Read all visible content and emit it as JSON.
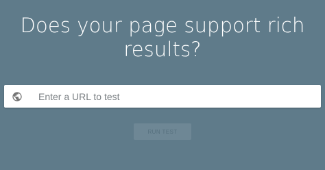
{
  "headline": {
    "line1": "Does your page support rich",
    "line2": "results?"
  },
  "url_field": {
    "value": "",
    "placeholder": "Enter a URL to test",
    "icon": "globe-icon"
  },
  "run_button": {
    "label": "RUN TEST",
    "disabled": true
  },
  "colors": {
    "background": "#5f7b8a",
    "headline_text": "#ffffff",
    "input_background": "#ffffff",
    "button_background": "#6e8795",
    "button_text": "#56707e"
  }
}
